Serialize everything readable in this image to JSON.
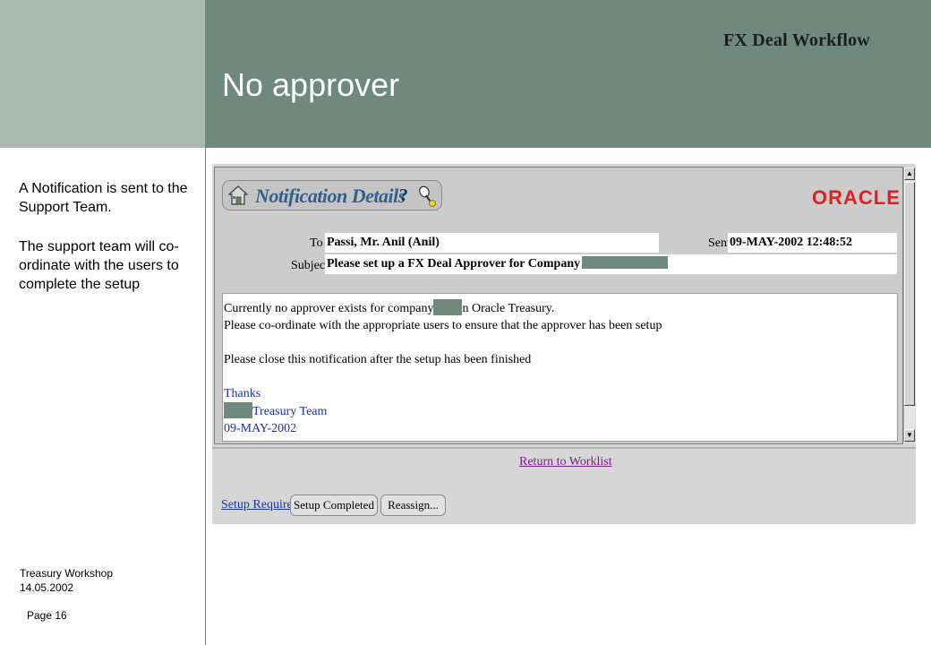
{
  "slide": {
    "title": "No approver",
    "header_label": "FX Deal Workflow",
    "side_note_1": "A Notification is sent to the Support Team.",
    "side_note_2": "The support team will co-ordinate with the users to complete the setup",
    "footer_workshop": "Treasury  Workshop",
    "footer_date": "14.05.2002",
    "footer_page": "Page 16",
    "colors": {
      "band": "#6f897e",
      "block": "#aab9b1"
    }
  },
  "notification": {
    "title": "Notification Details",
    "help_glyph": "?",
    "logo": "ORACLE",
    "to_label": "To",
    "to_value": "Passi, Mr. Anil (Anil)",
    "sent_label": "Sent",
    "sent_value": "09-MAY-2002 12:48:52",
    "subject_label": "Subject",
    "subject_value": "Please set up a FX Deal Approver for Company",
    "message": {
      "line1_a": "Currently no approver exists for company",
      "line1_b": "n Oracle Treasury.",
      "line2": "Please co-ordinate with the appropriate users to ensure that the approver has been setup",
      "line3": "Please close this notification after the setup has been finished",
      "line4": "Thanks",
      "line5": "Treasury Team",
      "line6": "09-MAY-2002"
    }
  },
  "actions": {
    "return_link": "Return to Worklist",
    "setup_required": "Setup Required",
    "setup_completed": "Setup Completed",
    "reassign": "Reassign..."
  },
  "icons": [
    "home-icon",
    "help-icon",
    "tools-icon",
    "scroll-up-icon",
    "scroll-down-icon"
  ]
}
